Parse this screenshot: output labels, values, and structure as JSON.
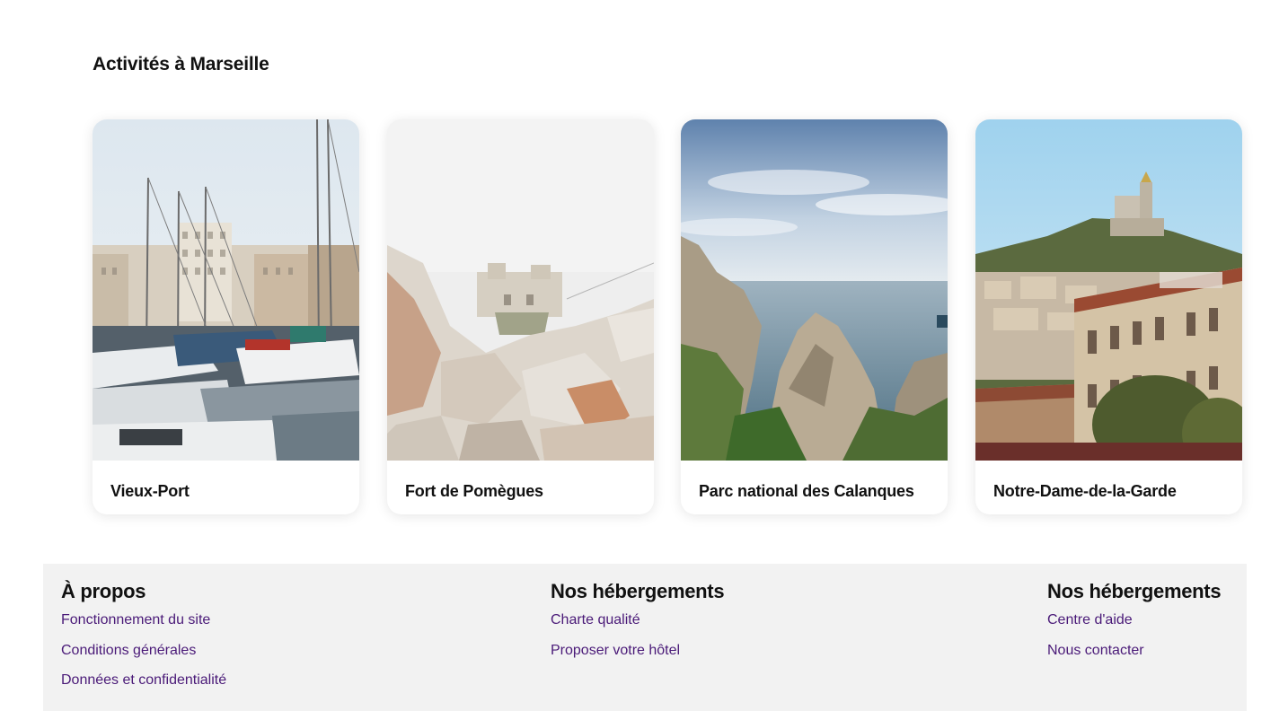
{
  "activities": {
    "title": "Activités à Marseille",
    "cards": [
      {
        "label": "Vieux-Port",
        "image": "harbor-boats-photo"
      },
      {
        "label": "Fort de Pomègues",
        "image": "rocky-fort-photo"
      },
      {
        "label": "Parc national des Calanques",
        "image": "calanques-coast-photo"
      },
      {
        "label": "Notre-Dame-de-la-Garde",
        "image": "basilica-hill-photo"
      }
    ]
  },
  "footer": {
    "columns": [
      {
        "title": "À propos",
        "links": [
          "Fonctionnement du site",
          "Conditions générales",
          "Données et confidentialité"
        ]
      },
      {
        "title": "Nos hébergements",
        "links": [
          "Charte qualité",
          "Proposer votre hôtel"
        ]
      },
      {
        "title": "Nos hébergements",
        "links": [
          "Centre d'aide",
          "Nous contacter"
        ]
      }
    ]
  },
  "colors": {
    "link": "#4a1a78",
    "footer_bg": "#f2f2f2",
    "text": "#111111"
  }
}
